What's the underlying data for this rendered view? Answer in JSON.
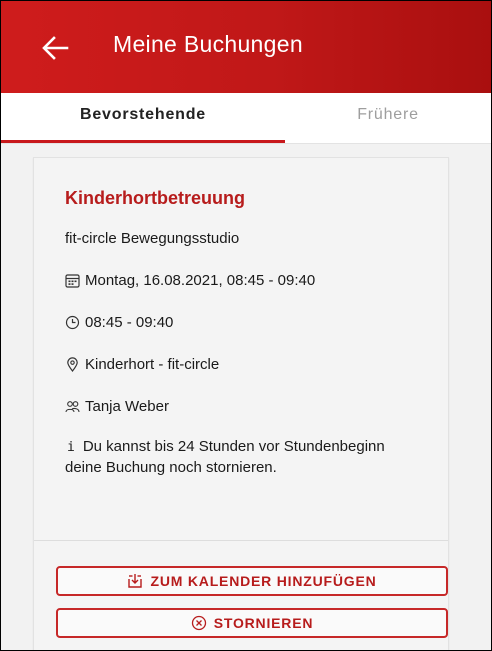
{
  "appbar": {
    "title": "Meine Buchungen",
    "back_icon": "arrow-left-icon"
  },
  "tabs": [
    {
      "label": "Bevorstehende",
      "active": true
    },
    {
      "label": "Frühere",
      "active": false
    }
  ],
  "booking": {
    "title": "Kinderhortbetreuung",
    "studio": "fit-circle Bewegungsstudio",
    "date": "Montag, 16.08.2021, 08:45 - 09:40",
    "time": "08:45 - 09:40",
    "location": "Kinderhort - fit-circle",
    "trainer": "Tanja Weber",
    "cancel_note": "Du kannst bis 24 Stunden vor Stundenbeginn deine Buchung noch stornieren."
  },
  "actions": {
    "calendar_label": "ZUM KALENDER HINZUFÜGEN",
    "cancel_label": "STORNIEREN"
  },
  "colors": {
    "primary": "#c8191c",
    "title_red": "#b71c1c"
  }
}
